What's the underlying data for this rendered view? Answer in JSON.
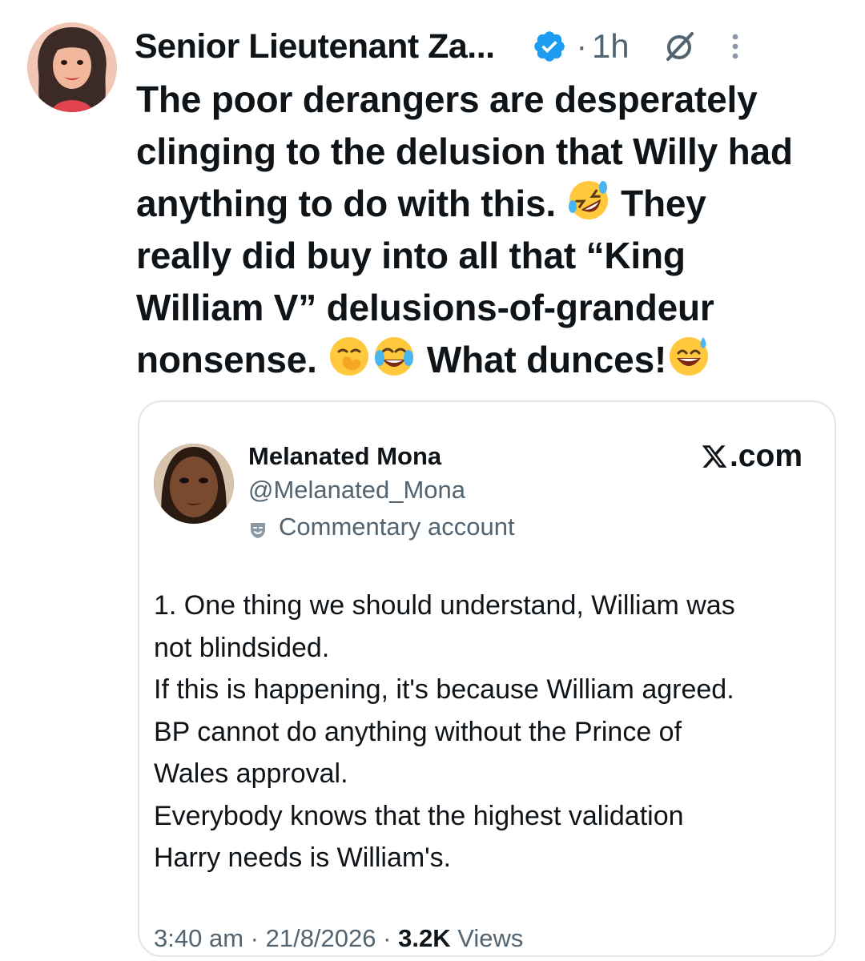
{
  "post": {
    "author_name": "Senior Lieutenant Za...",
    "separator": "·",
    "time": "1h",
    "icons": {
      "avatar": "profile-avatar-woman",
      "verified": "verified-badge-icon",
      "grok": "grok-icon",
      "more": "more-vertical-icon"
    },
    "text_lines": [
      "The poor derangers are desperately",
      "clinging to the delusion that Willy had",
      "anything to do with this.",
      "They",
      "really did buy into all that “King",
      "William V” delusions-of-grandeur",
      "nonsense.",
      "What dunces!"
    ],
    "emojis": [
      "rolling-on-floor-laughing",
      "face-with-hand-over-mouth",
      "face-with-tears-of-joy",
      "grinning-face-with-sweat"
    ]
  },
  "quoted_card": {
    "name": "Melanated Mona",
    "handle": "@Melanated_Mona",
    "badge_label": "Commentary account",
    "badge_icon": "theater-mask-icon",
    "site": ".com",
    "site_icon": "x-logo-icon",
    "body_lines": [
      "1. One thing we should understand, William was",
      "not blindsided.",
      "If this is happening, it's because William agreed.",
      "BP cannot do anything without the Prince of",
      "Wales approval.",
      "Everybody knows that the highest validation",
      "Harry needs is William's."
    ],
    "time": "3:40 am",
    "date": "21/8/2026",
    "views_count": "3.2K",
    "views_label": "Views",
    "dot": "·"
  },
  "colors": {
    "verified_blue": "#1d9bf0",
    "muted_text": "#536471",
    "primary_text": "#0f1419",
    "card_border": "#e1e6ea"
  }
}
